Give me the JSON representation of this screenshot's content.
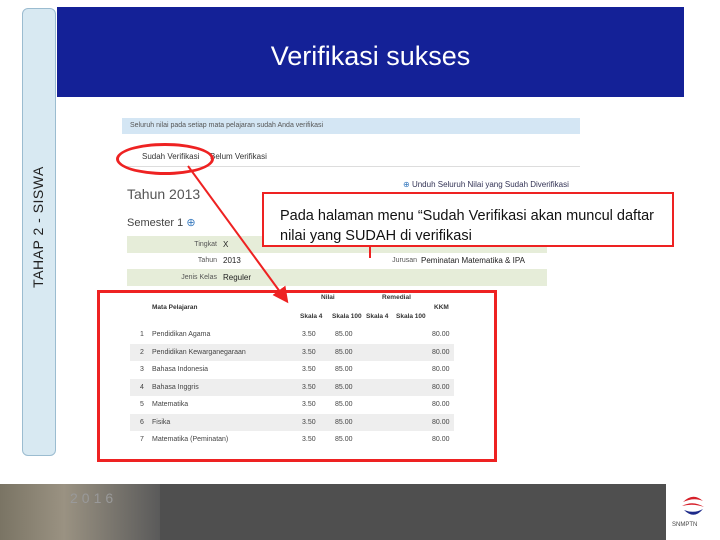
{
  "side_tab": "TAHAP 2 - SISWA",
  "banner_title": "Verifikasi sukses",
  "info_message": "Seluruh nilai pada setiap mata pelajaran sudah Anda verifikasi",
  "tabs": {
    "verified": "Sudah Verifikasi",
    "unverified": "Belum Verifikasi"
  },
  "year": "Tahun 2013",
  "download_label": "Unduh Seluruh Nilai yang Sudah Diverifikasi",
  "download_icon": "download-icon",
  "semester": "Semester 1",
  "semester_icon": "plus-circle-icon",
  "class_info": {
    "tingkat_label": "Tingkat",
    "tingkat_value": "X",
    "tahun_label": "Tahun",
    "tahun_value": "2013",
    "jurusan_label": "Jurusan",
    "jurusan_value": "Peminatan Matematika & IPA",
    "jenis_label": "Jenis Kelas",
    "jenis_value": "Reguler"
  },
  "callout_text": "Pada halaman menu “Sudah Verifikasi akan muncul daftar nilai yang SUDAH di verifikasi",
  "table": {
    "subject_header": "Mata Pelajaran",
    "nilai_header": "Nilai",
    "remedial_header": "Remedial",
    "kkm_header": "KKM",
    "sub_headers": [
      "Skala 4",
      "Skala 100",
      "Skala 4",
      "Skala 100"
    ],
    "rows": [
      {
        "no": "1",
        "subject": "Pendidikan Agama",
        "s4": "3.50",
        "s100": "85.00",
        "kkm": "80.00"
      },
      {
        "no": "2",
        "subject": "Pendidikan Kewarganegaraan",
        "s4": "3.50",
        "s100": "85.00",
        "kkm": "80.00"
      },
      {
        "no": "3",
        "subject": "Bahasa Indonesia",
        "s4": "3.50",
        "s100": "85.00",
        "kkm": "80.00"
      },
      {
        "no": "4",
        "subject": "Bahasa Inggris",
        "s4": "3.50",
        "s100": "85.00",
        "kkm": "80.00"
      },
      {
        "no": "5",
        "subject": "Matematika",
        "s4": "3.50",
        "s100": "85.00",
        "kkm": "80.00"
      },
      {
        "no": "6",
        "subject": "Fisika",
        "s4": "3.50",
        "s100": "85.00",
        "kkm": "80.00"
      },
      {
        "no": "7",
        "subject": "Matematika (Peminatan)",
        "s4": "3.50",
        "s100": "85.00",
        "kkm": "80.00"
      }
    ]
  },
  "footer_year": "2016",
  "footer_logo_text": "SNMPTN",
  "colors": {
    "banner": "#142197",
    "annotation": "#ee2222",
    "side_tab": "#d8e9f2"
  }
}
